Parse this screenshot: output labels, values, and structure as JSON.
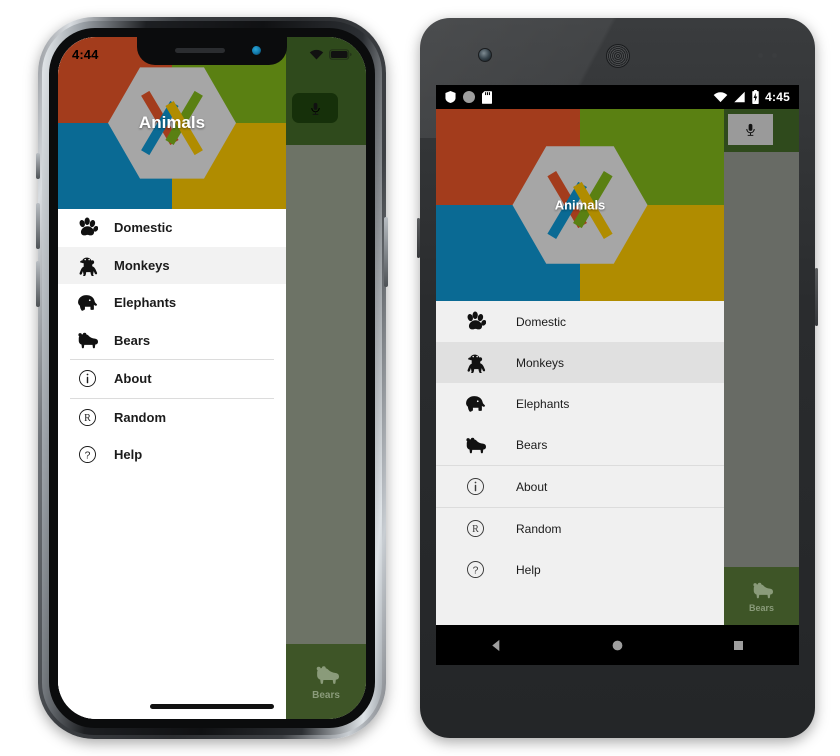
{
  "app": {
    "title": "Animals",
    "logo_icon": "xamarin-hexagon-logo",
    "brand_colors": {
      "top_left": "#a33c1c",
      "top_right": "#5a8012",
      "bottom_left": "#0a6a94",
      "bottom_right": "#b08c00",
      "hexagon": "#a6a6a6",
      "content_green": "#3e5527",
      "selected_row_ios": "#f2f2f2",
      "selected_row_android": "#e0e0e0",
      "drawer_bg_ios": "#ffffff",
      "drawer_bg_android": "#f0f0f0"
    },
    "menu": [
      {
        "icon": "paw-icon",
        "label": "Domestic",
        "selected": false
      },
      {
        "icon": "monkey-icon",
        "label": "Monkeys",
        "selected": true
      },
      {
        "icon": "elephant-icon",
        "label": "Elephants",
        "selected": false
      },
      {
        "icon": "bear-icon",
        "label": "Bears",
        "selected": false
      },
      {
        "icon": "info-circle-icon",
        "label": "About",
        "selected": false
      },
      {
        "icon": "r-circle-icon",
        "label": "Random",
        "selected": false
      },
      {
        "icon": "question-circle-icon",
        "label": "Help",
        "selected": false
      }
    ],
    "content": {
      "mic_button_icon": "microphone-icon",
      "tab_label": "Bears",
      "tab_icon": "bear-icon"
    }
  },
  "ios": {
    "device_name": "iPhone X",
    "status_bar": {
      "time": "4:44",
      "wifi_icon": "wifi-icon",
      "battery_icon": "battery-full-icon"
    },
    "notch_icons": {
      "speaker": "earpiece-speaker",
      "camera": "front-camera"
    },
    "home_indicator": "home-indicator"
  },
  "android": {
    "device_name": "Nexus 5",
    "status_bar": {
      "time": "4:45",
      "left_icons": [
        "shield-icon",
        "circle-icon",
        "sd-card-icon"
      ],
      "right_icons": [
        "wifi-icon",
        "signal-icon",
        "battery-charging-icon"
      ]
    },
    "nav_bar": {
      "back_label": "Back",
      "home_label": "Home",
      "recents_label": "Recents",
      "back_icon": "triangle-back-icon",
      "home_icon": "circle-home-icon",
      "recents_icon": "square-recents-icon"
    },
    "hardware": {
      "camera": "front-camera",
      "speaker": "earpiece-speaker",
      "sensor": "proximity-sensor"
    }
  }
}
